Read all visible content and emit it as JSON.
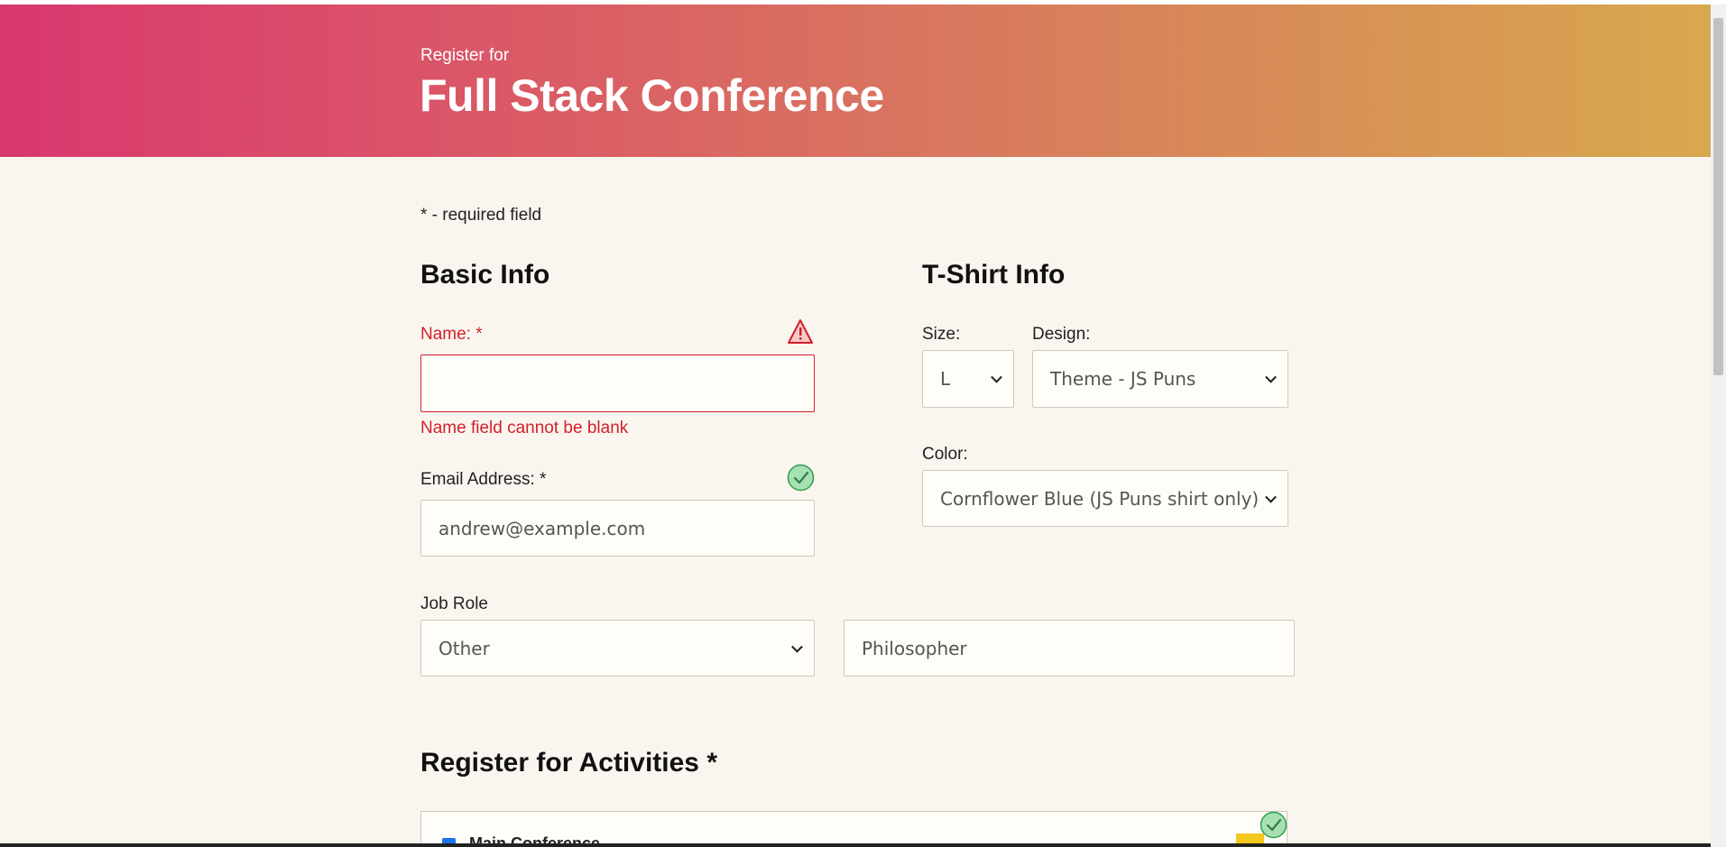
{
  "header": {
    "pre_title": "Register for",
    "title": "Full Stack Conference"
  },
  "required_note": "* - required field",
  "basic_info": {
    "heading": "Basic Info",
    "name": {
      "label": "Name: *",
      "value": "",
      "error": "Name field cannot be blank",
      "status_icon": "warning-icon"
    },
    "email": {
      "label": "Email Address: *",
      "value": "andrew@example.com",
      "status_icon": "check-icon"
    },
    "job_role": {
      "label": "Job Role",
      "selected": "Other",
      "other_value": "Philosopher"
    }
  },
  "tshirt_info": {
    "heading": "T-Shirt Info",
    "size": {
      "label": "Size:",
      "selected": "L"
    },
    "design": {
      "label": "Design:",
      "selected": "Theme - JS Puns"
    },
    "color": {
      "label": "Color:",
      "selected": "Cornflower Blue (JS Puns shirt only)"
    }
  },
  "activities": {
    "heading": "Register for Activities *",
    "first_item": "Main Conference",
    "status_icon": "check-icon"
  },
  "colors": {
    "error": "#d21f2a",
    "valid": "#2e9e4f",
    "background": "#faf6ef",
    "header_gradient_start": "#d9386f",
    "header_gradient_end": "#d8a84e"
  }
}
